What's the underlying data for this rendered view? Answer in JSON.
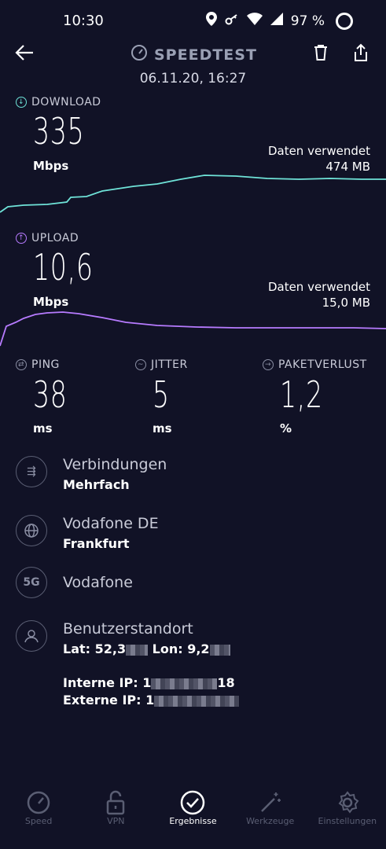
{
  "status_bar": {
    "time": "10:30",
    "battery": "97 %"
  },
  "header": {
    "title": "SPEEDTEST",
    "date": "06.11.20, 16:27"
  },
  "download": {
    "label": "DOWNLOAD",
    "value": "335",
    "unit": "Mbps",
    "data_used_label": "Daten verwendet",
    "data_used_value": "474 MB"
  },
  "upload": {
    "label": "UPLOAD",
    "value": "10,6",
    "unit": "Mbps",
    "data_used_label": "Daten verwendet",
    "data_used_value": "15,0 MB"
  },
  "metrics": [
    {
      "label": "PING",
      "value": "38",
      "unit": "ms"
    },
    {
      "label": "JITTER",
      "value": "5",
      "unit": "ms"
    },
    {
      "label": "PAKETVERLUST",
      "value": "1,2",
      "unit": "%"
    }
  ],
  "info": {
    "connections": {
      "title": "Verbindungen",
      "value": "Mehrfach"
    },
    "provider": {
      "title": "Vodafone DE",
      "value": "Frankfurt"
    },
    "network": {
      "badge": "5G",
      "title": "Vodafone"
    },
    "location": {
      "title": "Benutzerstandort",
      "lat_label": "Lat: 52,3",
      "lon_label": "Lon: 9,2",
      "internal_ip_label": "Interne IP: 1",
      "internal_ip_tail": "18",
      "external_ip_label": "Externe IP: 1"
    }
  },
  "colors": {
    "background": "#111226",
    "download": "#6fe3d8",
    "upload": "#b77bff"
  },
  "nav": [
    {
      "label": "Speed",
      "icon": "speedometer-icon",
      "active": false
    },
    {
      "label": "VPN",
      "icon": "lock-icon",
      "active": false
    },
    {
      "label": "Ergebnisse",
      "icon": "checkmark-circle-icon",
      "active": true
    },
    {
      "label": "Werkzeuge",
      "icon": "magic-wand-icon",
      "active": false
    },
    {
      "label": "Einstellungen",
      "icon": "gear-icon",
      "active": false
    }
  ]
}
